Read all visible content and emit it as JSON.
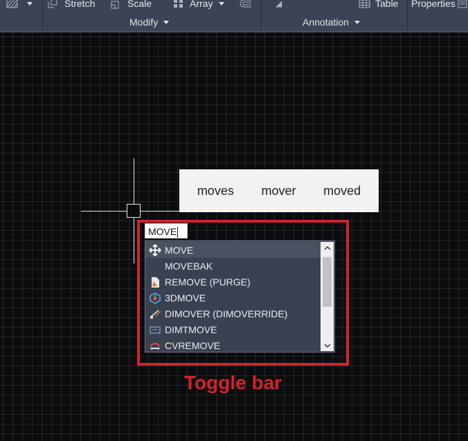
{
  "ribbon": {
    "tools": [
      {
        "label": "Stretch",
        "icon": "stretch-icon"
      },
      {
        "label": "Scale",
        "icon": "scale-icon"
      },
      {
        "label": "Array",
        "icon": "array-icon"
      },
      {
        "label": "Table",
        "icon": "table-icon"
      },
      {
        "label": "Properties",
        "icon": "properties-icon"
      }
    ],
    "panels": {
      "modify": "Modify",
      "annotation": "Annotation"
    }
  },
  "suggestions": [
    "moves",
    "mover",
    "moved"
  ],
  "command": {
    "value": "MOVE"
  },
  "autocomplete": {
    "items": [
      {
        "label": "MOVE",
        "icon": "move-arrows-icon"
      },
      {
        "label": "MOVEBAK",
        "icon": ""
      },
      {
        "label": "REMOVE (PURGE)",
        "icon": "purge-icon"
      },
      {
        "label": "3DMOVE",
        "icon": "3dmove-icon"
      },
      {
        "label": "DIMOVER (DIMOVERRIDE)",
        "icon": "dimoverride-icon"
      },
      {
        "label": "DIMTMOVE",
        "icon": "dimtmove-icon"
      },
      {
        "label": "CVREMOVE",
        "icon": "cvremove-icon"
      }
    ]
  },
  "annotation_label": "Toggle bar",
  "colors": {
    "ribbon": "#3b4453",
    "highlight": "#d4222a",
    "list_bg": "#3a4150"
  }
}
